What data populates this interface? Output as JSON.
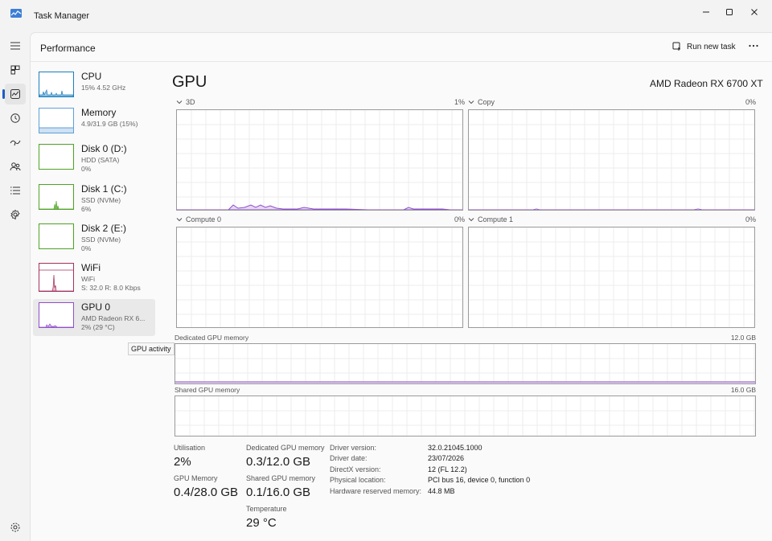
{
  "window": {
    "title": "Task Manager",
    "icon": "task-manager-icon"
  },
  "header": {
    "section_title": "Performance",
    "run_new_task": "Run new task",
    "more_icon": "more-options-icon"
  },
  "nav": [
    "hamburger-icon",
    "processes-icon",
    "performance-icon",
    "app-history-icon",
    "startup-apps-icon",
    "users-icon",
    "details-icon",
    "services-icon",
    "settings-icon"
  ],
  "sidebar": [
    {
      "name": "CPU",
      "line1": "15% 4.52 GHz",
      "line2": ""
    },
    {
      "name": "Memory",
      "line1": "4.9/31.9 GB (15%)",
      "line2": ""
    },
    {
      "name": "Disk 0 (D:)",
      "line1": "HDD (SATA)",
      "line2": "0%"
    },
    {
      "name": "Disk 1 (C:)",
      "line1": "SSD (NVMe)",
      "line2": "6%"
    },
    {
      "name": "Disk 2 (E:)",
      "line1": "SSD (NVMe)",
      "line2": "0%"
    },
    {
      "name": "WiFi",
      "line1": "WiFi",
      "line2": "S: 32.0 R: 8.0 Kbps"
    },
    {
      "name": "GPU 0",
      "line1": "AMD Radeon RX 6...",
      "line2": "2% (29 °C)"
    }
  ],
  "tooltip": "GPU activity",
  "gpu": {
    "title": "GPU",
    "model": "AMD Radeon RX 6700 XT",
    "engines": [
      {
        "label": "3D",
        "pct": "1%"
      },
      {
        "label": "Copy",
        "pct": "0%"
      },
      {
        "label": "Compute 0",
        "pct": "0%"
      },
      {
        "label": "Compute 1",
        "pct": "0%"
      }
    ],
    "dedicated": {
      "label": "Dedicated GPU memory",
      "max": "12.0 GB"
    },
    "shared": {
      "label": "Shared GPU memory",
      "max": "16.0 GB"
    }
  },
  "stats": {
    "utilisation_label": "Utilisation",
    "utilisation": "2%",
    "dedicated_label": "Dedicated GPU memory",
    "dedicated": "0.3/12.0 GB",
    "gpu_memory_label": "GPU Memory",
    "gpu_memory": "0.4/28.0 GB",
    "shared_label": "Shared GPU memory",
    "shared": "0.1/16.0 GB",
    "temperature_label": "Temperature",
    "temperature": "29 °C"
  },
  "info": [
    {
      "key": "Driver version:",
      "value": "32.0.21045.1000"
    },
    {
      "key": "Driver date:",
      "value": "23/07/2026"
    },
    {
      "key": "DirectX version:",
      "value": "12 (FL 12.2)"
    },
    {
      "key": "Physical location:",
      "value": "PCI bus 16, device 0, function 0"
    },
    {
      "key": "Hardware reserved memory:",
      "value": "44.8 MB"
    }
  ],
  "colors": {
    "accent": "#1f5bc5",
    "cpu": "#1a7fbd",
    "memory": "#5f9fd6",
    "disk": "#4ea324",
    "wifi": "#a3325e",
    "gpu": "#8f4fcb"
  }
}
